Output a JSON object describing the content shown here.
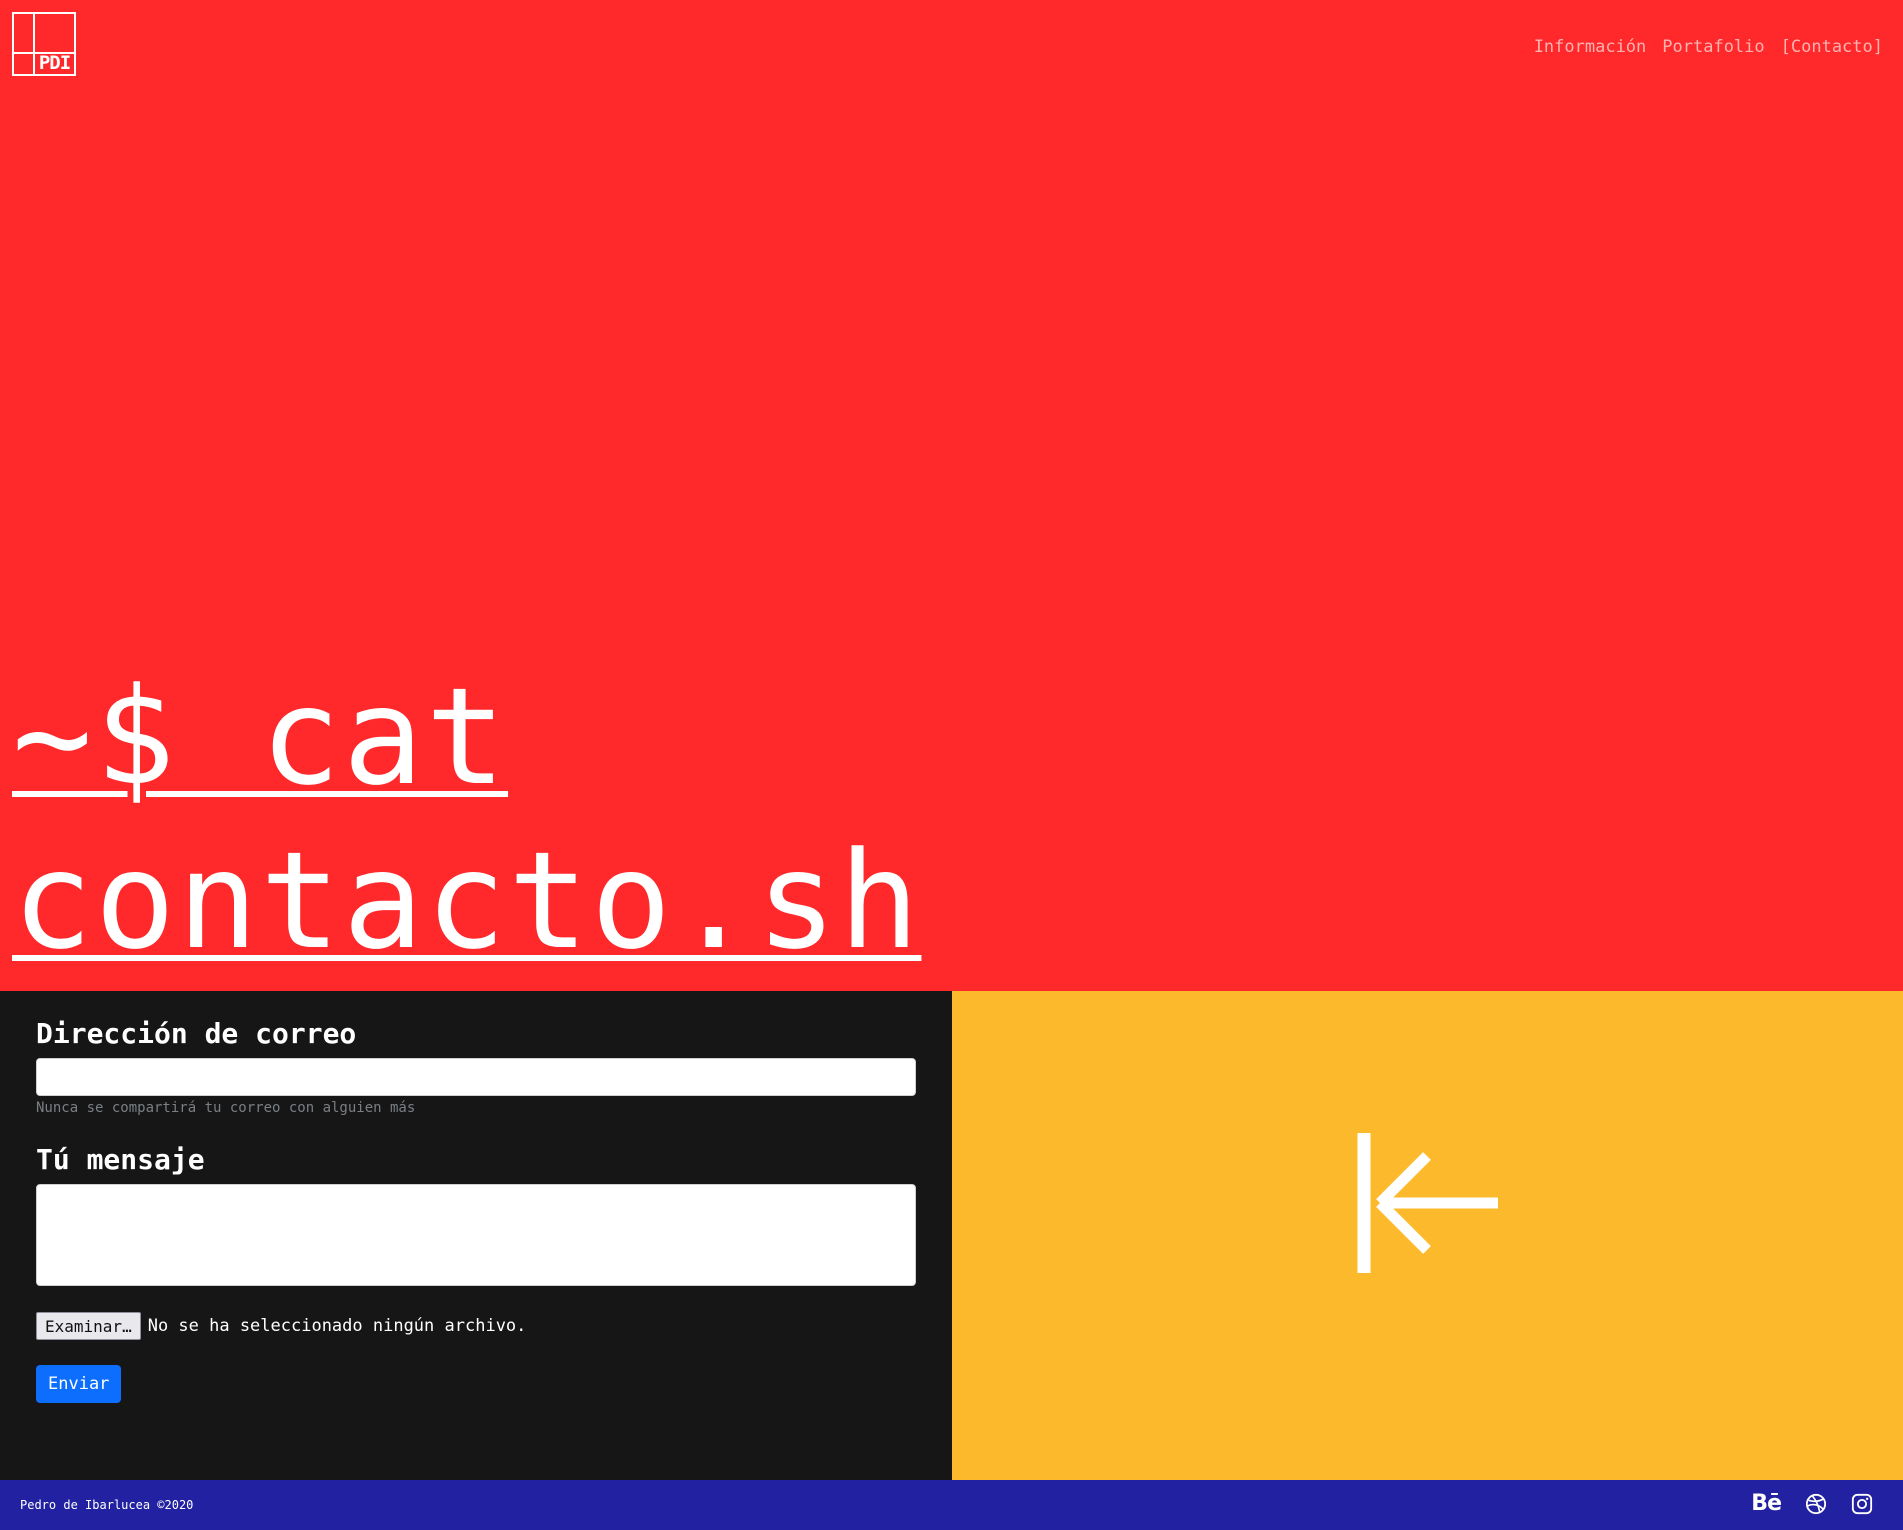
{
  "brand": {
    "logo_text": "PDI"
  },
  "nav": {
    "items": [
      {
        "label": "Información"
      },
      {
        "label": "Portafolio"
      },
      {
        "label": "[Contacto]"
      }
    ]
  },
  "hero": {
    "headline_line1": "~$ cat",
    "headline_line2": "contacto.sh"
  },
  "form": {
    "email_label": "Dirección de correo",
    "email_value": "",
    "email_help": "Nunca se compartirá tu correo con alguien más",
    "message_label": "Tú mensaje",
    "message_value": "",
    "file_button": "Examinar…",
    "file_status": "No se ha seleccionado ningún archivo.",
    "submit_label": "Enviar"
  },
  "footer": {
    "copyright": "Pedro de Ibarlucea ©2020",
    "social": {
      "behance_label": "Bē"
    }
  },
  "colors": {
    "hero_bg": "#ff282b",
    "form_bg": "#161616",
    "yellow_bg": "#fcb92b",
    "footer_bg": "#2121a1",
    "primary_button": "#0d6efd"
  },
  "icons": [
    "back-arrow-icon",
    "behance-icon",
    "dribbble-icon",
    "instagram-icon"
  ]
}
